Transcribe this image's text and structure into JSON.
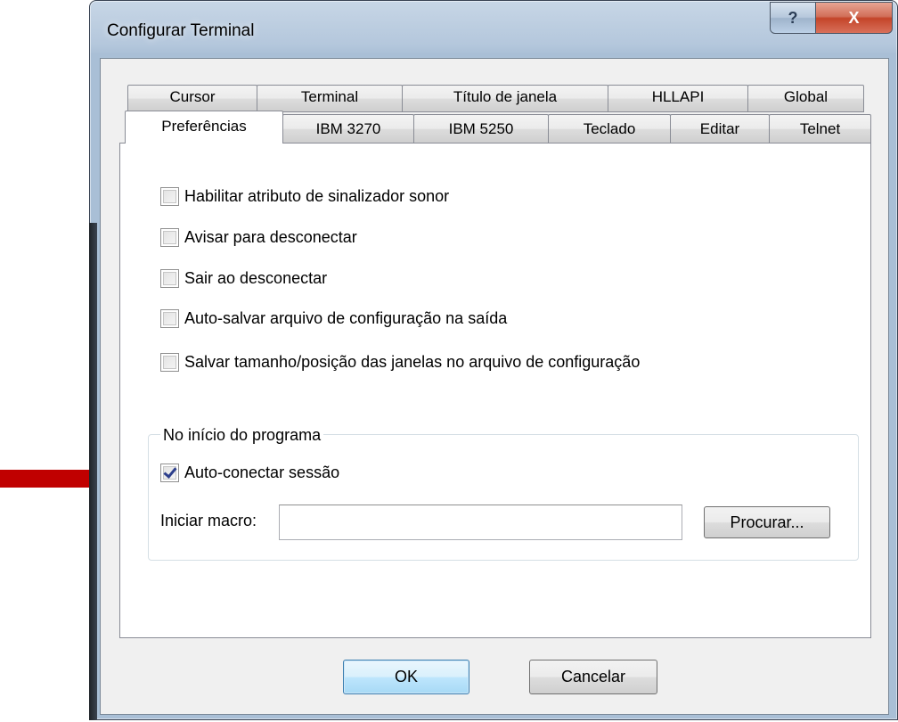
{
  "window": {
    "title": "Configurar Terminal",
    "help_label": "?",
    "close_label": "X"
  },
  "tabs_back_row": [
    {
      "label": "Cursor"
    },
    {
      "label": "Terminal"
    },
    {
      "label": "Título de janela"
    },
    {
      "label": "HLLAPI"
    },
    {
      "label": "Global"
    }
  ],
  "tabs_front_row": [
    {
      "label": "Preferências",
      "active": true
    },
    {
      "label": "IBM 3270"
    },
    {
      "label": "IBM 5250"
    },
    {
      "label": "Teclado"
    },
    {
      "label": "Editar"
    },
    {
      "label": "Telnet"
    }
  ],
  "options": [
    {
      "label": "Habilitar atributo de sinalizador sonor",
      "checked": false
    },
    {
      "label": "Avisar para desconectar",
      "checked": false
    },
    {
      "label": "Sair ao desconectar",
      "checked": false
    },
    {
      "label": "Auto-salvar arquivo de configuração na saída",
      "checked": false
    },
    {
      "label": "Salvar tamanho/posição das janelas no arquivo de configuração",
      "checked": false
    }
  ],
  "startup_group": {
    "legend": "No início do programa",
    "auto_connect": {
      "label": "Auto-conectar sessão",
      "checked": true
    },
    "macro_label": "Iniciar macro:",
    "macro_value": "",
    "browse_label": "Procurar..."
  },
  "footer": {
    "ok_label": "OK",
    "cancel_label": "Cancelar"
  },
  "colors": {
    "annotation_arrow": "#c00000",
    "checkmark": "#2d3f8c"
  }
}
